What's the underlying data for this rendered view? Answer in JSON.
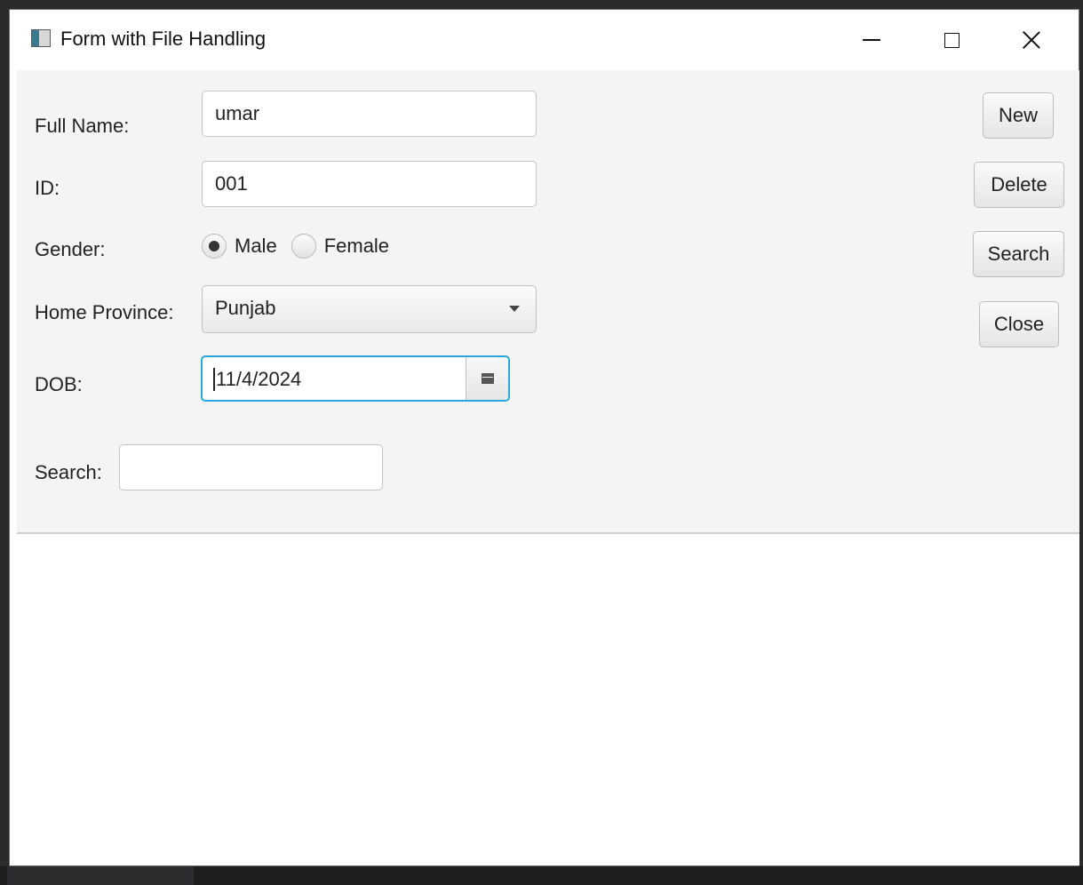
{
  "window": {
    "title": "Form with File Handling",
    "controls": [
      "minimize",
      "maximize",
      "close"
    ]
  },
  "form": {
    "full_name": {
      "label": "Full Name:",
      "value": "umar"
    },
    "id": {
      "label": "ID:",
      "value": "001"
    },
    "gender": {
      "label": "Gender:",
      "options": [
        {
          "label": "Male",
          "selected": true
        },
        {
          "label": "Female",
          "selected": false
        }
      ]
    },
    "home_province": {
      "label": "Home Province:",
      "value": "Punjab"
    },
    "dob": {
      "label": "DOB:",
      "value": "11/4/2024"
    },
    "search": {
      "label": "Search:",
      "value": ""
    }
  },
  "actions": {
    "new_label": "New",
    "delete_label": "Delete",
    "search_label": "Search",
    "close_label": "Close"
  },
  "colors": {
    "focus_accent": "#2aa7dc",
    "pane_background": "#f4f4f4"
  },
  "icons": {
    "app": "app-icon",
    "minimize": "minimize-icon",
    "maximize": "maximize-icon",
    "close": "close-icon",
    "dropdown": "chevron-down-icon",
    "calendar": "calendar-icon"
  }
}
